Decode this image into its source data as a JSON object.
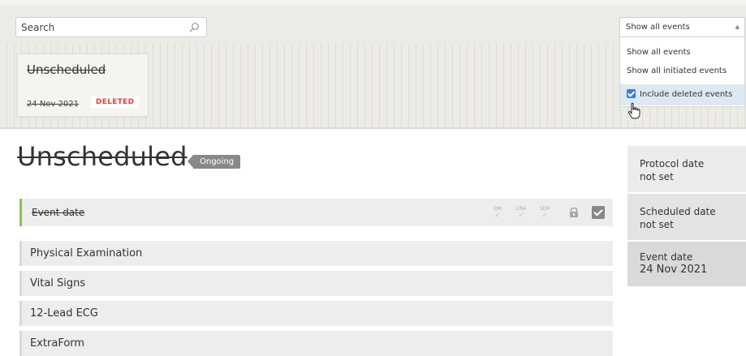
{
  "search": {
    "placeholder": "Search"
  },
  "event_card": {
    "title": "Unscheduled",
    "date": "24 Nov 2021",
    "badge": "DELETED"
  },
  "filter_dropdown": {
    "selected": "Show all events",
    "options": [
      {
        "label": "Show all events"
      },
      {
        "label": "Show all initiated events"
      },
      {
        "label": "Include deleted events",
        "checked": true
      }
    ]
  },
  "main": {
    "title": "Unscheduled",
    "status": "Ongoing",
    "event_date_row": {
      "label": "Event date",
      "icons": [
        {
          "label": "DM",
          "name": "dm-verify-icon"
        },
        {
          "label": "CRA",
          "name": "cra-verify-icon"
        },
        {
          "label": "SDV",
          "name": "sdv-verify-icon"
        },
        {
          "name": "lock-icon"
        },
        {
          "name": "checkbox-icon"
        }
      ]
    },
    "forms": [
      "Physical Examination",
      "Vital Signs",
      "12-Lead ECG",
      "ExtraForm"
    ]
  },
  "side_panel": {
    "protocol_label": "Protocol date",
    "protocol_value": "not set",
    "scheduled_label": "Scheduled date",
    "scheduled_value": "not set",
    "event_label": "Event date",
    "event_value": "24 Nov 2021"
  },
  "colors": {
    "accent_green": "#8bbf57",
    "deleted_red": "#d9443f",
    "badge_gray": "#898989",
    "checkbox_blue": "#3d7fd3",
    "highlight_blue": "#dde8f3"
  }
}
